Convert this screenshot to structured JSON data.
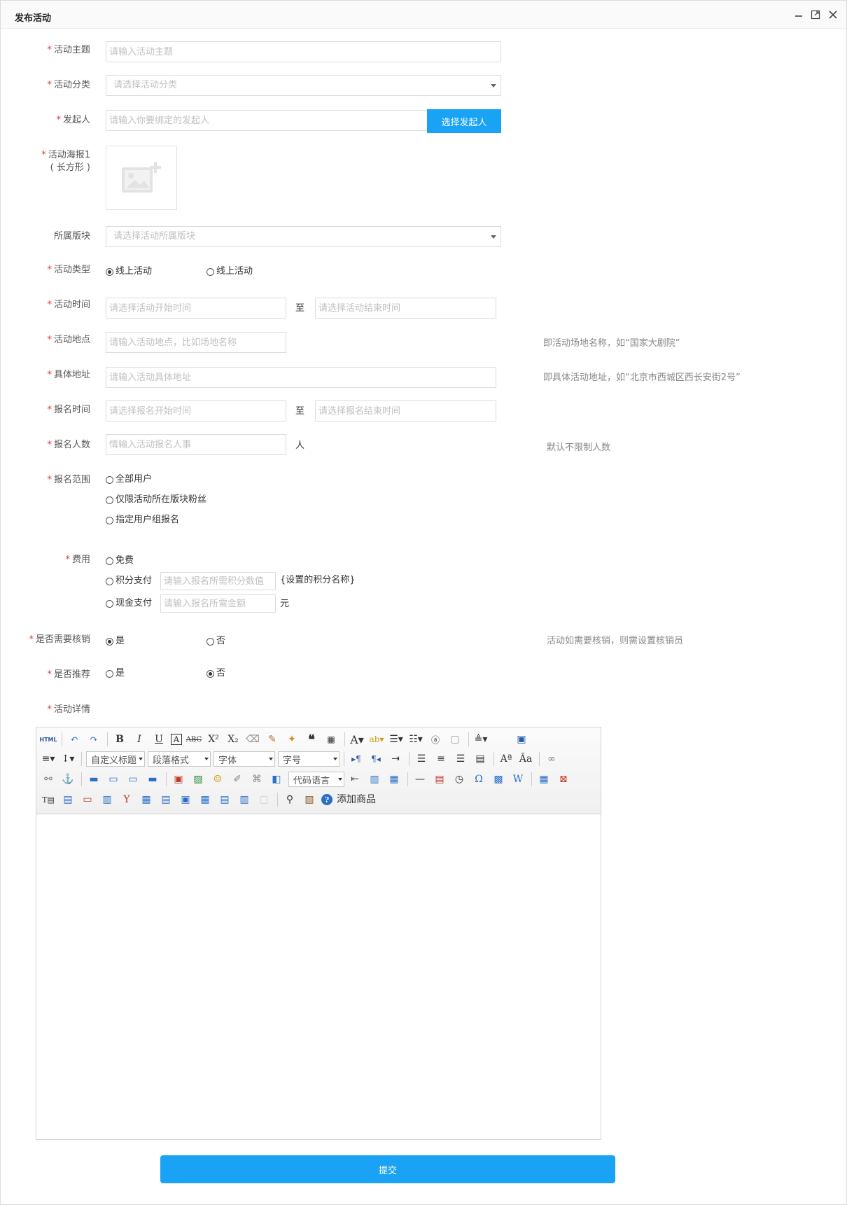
{
  "window": {
    "title": "发布活动"
  },
  "form": {
    "theme": {
      "label": "活动主题",
      "placeholder": "请输入活动主题"
    },
    "category": {
      "label": "活动分类",
      "placeholder": "请选择活动分类"
    },
    "initiator": {
      "label": "发起人",
      "placeholder": "请输入你要绑定的发起人",
      "button": "选择发起人"
    },
    "poster": {
      "label": "活动海报1",
      "sublabel": "( 长方形 )"
    },
    "section": {
      "label": "所属版块",
      "placeholder": "请选择活动所属版块"
    },
    "type": {
      "label": "活动类型",
      "options": [
        "线上活动",
        "线上活动"
      ],
      "selected": 0
    },
    "time": {
      "label": "活动时间",
      "start_placeholder": "请选择活动开始时间",
      "end_placeholder": "请选择活动结束时间",
      "to": "至"
    },
    "location": {
      "label": "活动地点",
      "placeholder": "请输入活动地点，比如场地名称",
      "hint": "即活动场地名称，如“国家大剧院”"
    },
    "address": {
      "label": "具体地址",
      "placeholder": "请输入活动具体地址",
      "hint": "即具体活动地址，如“北京市西城区西长安街2号”"
    },
    "signup_time": {
      "label": "报名时间",
      "start_placeholder": "请选择报名开始时间",
      "end_placeholder": "请选择报名结束时间",
      "to": "至"
    },
    "signup_count": {
      "label": "报名人数",
      "placeholder": "情输入活动报名人事",
      "unit": "人",
      "hint": "默认不限制人数"
    },
    "signup_scope": {
      "label": "报名范围",
      "options": [
        "全部用户",
        "仅限活动所在版块粉丝",
        "指定用户组报名"
      ]
    },
    "fee": {
      "label": "费用",
      "free": "免费",
      "points": "积分支付",
      "points_placeholder": "请输入报名所需积分数值",
      "points_unit": "{设置的积分名称}",
      "cash": "现金支付",
      "cash_placeholder": "请输入报名所需金额",
      "cash_unit": "元"
    },
    "verify": {
      "label": "是否需要核销",
      "options": [
        "是",
        "否"
      ],
      "selected": 0,
      "hint": "活动如需要核销，则需设置核销员"
    },
    "recommend": {
      "label": "是否推荐",
      "options": [
        "是",
        "否"
      ],
      "selected": 1
    },
    "details": {
      "label": "活动详情"
    }
  },
  "editor": {
    "combos": {
      "heading": "自定义标题",
      "paragraph": "段落格式",
      "font": "字体",
      "size": "字号",
      "code": "代码语言"
    },
    "add_product": "添加商品",
    "html_label": "HTML"
  },
  "submit_label": "提交",
  "colors": {
    "accent": "#1aa3f5",
    "required": "#e4393c"
  }
}
